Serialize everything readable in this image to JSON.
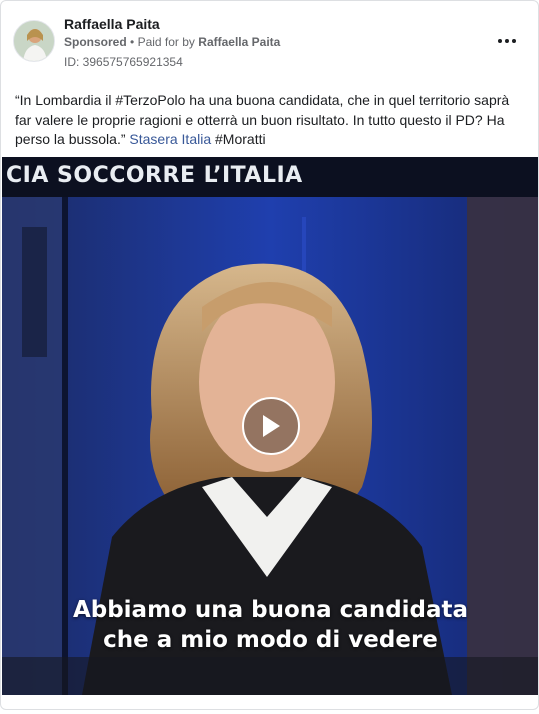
{
  "post": {
    "author": "Raffaella Paita",
    "sponsored_label": "Sponsored",
    "paid_prefix": "Paid for by",
    "paid_by": "Raffaella Paita",
    "ad_id": "ID: 396575765921354",
    "caption_text": "“In Lombardia il #TerzoPolo ha una buona candidata, che in quel territorio saprà far valere le proprie ragioni e otterrà un buon risultato. In tutto questo il PD? Ha perso la bussola.” ",
    "caption_link": "Stasera Italia",
    "caption_hashtag": " #Moratti"
  },
  "video": {
    "overlay_title": "CIA SOCCORRE L’ITALIA",
    "subtitle_line1": "Abbiamo una buona candidata",
    "subtitle_line2": "che a mio modo di vedere"
  },
  "icons": {
    "more": "more-options-icon",
    "play": "play-icon",
    "avatar": "profile-avatar"
  },
  "colors": {
    "link": "#385898",
    "secondary_text": "#65676b",
    "primary_text": "#1c1e21"
  }
}
